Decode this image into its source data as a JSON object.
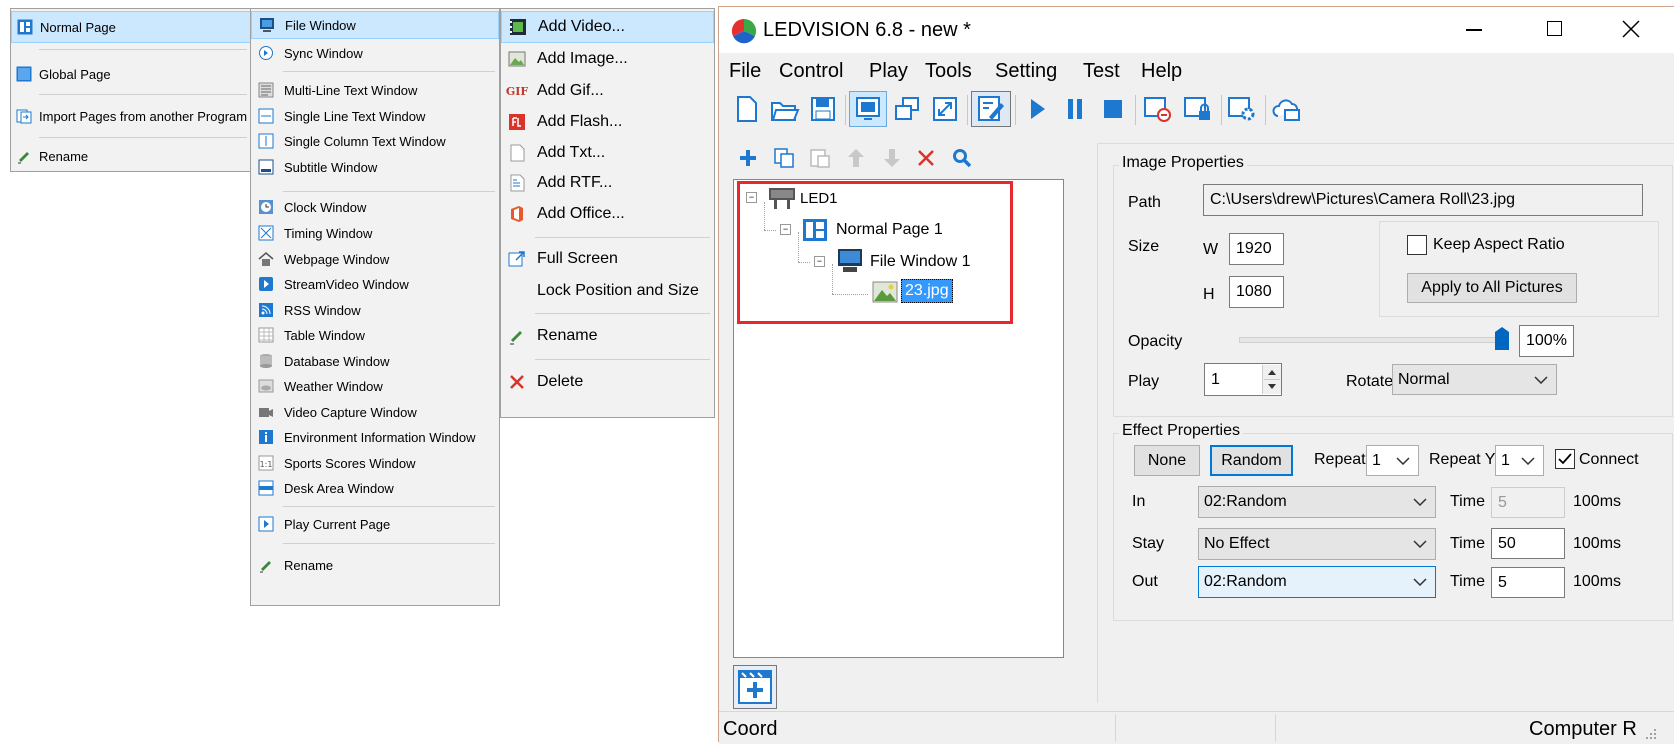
{
  "page_menu": {
    "items": [
      {
        "label": "Normal Page",
        "icon": "normal-page-icon"
      },
      {
        "label": "Global Page",
        "icon": "global-page-icon"
      },
      {
        "label": "Import Pages from another Program",
        "icon": "import-pages-icon"
      },
      {
        "label": "Rename",
        "icon": "rename-pen-icon"
      }
    ]
  },
  "window_menu": {
    "items": [
      {
        "label": "File Window"
      },
      {
        "label": "Sync Window"
      },
      {
        "label": "Multi-Line Text Window"
      },
      {
        "label": "Single Line Text Window"
      },
      {
        "label": "Single Column Text Window"
      },
      {
        "label": "Subtitle Window"
      },
      {
        "label": "Clock Window"
      },
      {
        "label": "Timing Window"
      },
      {
        "label": "Webpage Window"
      },
      {
        "label": "StreamVideo Window"
      },
      {
        "label": "RSS Window"
      },
      {
        "label": "Table Window"
      },
      {
        "label": "Database Window"
      },
      {
        "label": "Weather Window"
      },
      {
        "label": "Video Capture Window"
      },
      {
        "label": "Environment Information Window"
      },
      {
        "label": "Sports Scores Window"
      },
      {
        "label": "Desk Area Window"
      },
      {
        "label": "Play Current Page"
      },
      {
        "label": "Rename"
      }
    ]
  },
  "add_menu": {
    "items": [
      {
        "label": "Add Video..."
      },
      {
        "label": "Add Image..."
      },
      {
        "label": "Add Gif...",
        "icon_text": "GIF"
      },
      {
        "label": "Add Flash..."
      },
      {
        "label": "Add Txt..."
      },
      {
        "label": "Add RTF..."
      },
      {
        "label": "Add Office..."
      },
      {
        "label": "Full Screen"
      },
      {
        "label": "Lock Position and Size"
      },
      {
        "label": "Rename"
      },
      {
        "label": "Delete"
      }
    ]
  },
  "app": {
    "title": "LEDVISION 6.8 - new *",
    "menubar": [
      "File",
      "Control",
      "Play",
      "Tools",
      "Setting",
      "Test",
      "Help"
    ],
    "tree": {
      "led": "LED1",
      "page": "Normal Page 1",
      "window": "File Window 1",
      "file": "23.jpg"
    },
    "image_props": {
      "title": "Image Properties",
      "path_label": "Path",
      "path_value": "C:\\Users\\drew\\Pictures\\Camera Roll\\23.jpg",
      "size_label": "Size",
      "w_label": "W",
      "w_value": "1920",
      "h_label": "H",
      "h_value": "1080",
      "keep_aspect": "Keep Aspect Ratio",
      "keep_aspect_checked": false,
      "apply_all": "Apply to All Pictures",
      "opacity_label": "Opacity",
      "opacity_value": "100%",
      "opacity_level": 1.0,
      "play_label": "Play",
      "play_value": "1",
      "rotate_label": "Rotate",
      "rotate_value": "Normal"
    },
    "effect_props": {
      "title": "Effect Properties",
      "none_btn": "None",
      "random_btn": "Random",
      "repeat_label": "Repeat",
      "repeat_value": "1",
      "repeat_y_label": "Repeat Y",
      "repeat_y_value": "1",
      "connect_label": "Connect",
      "connect_checked": true,
      "rows": [
        {
          "label": "In",
          "effect": "02:Random",
          "time_label": "Time",
          "time": "5",
          "unit": "100ms"
        },
        {
          "label": "Stay",
          "effect": "No Effect",
          "time_label": "Time",
          "time": "50",
          "unit": "100ms"
        },
        {
          "label": "Out",
          "effect": "02:Random",
          "time_label": "Time",
          "time": "5",
          "unit": "100ms"
        }
      ]
    },
    "status": {
      "left": "Coord",
      "right": "Computer R"
    },
    "colors": {
      "highlight": "#cce8ff",
      "accent_blue": "#1e78d0",
      "tree_box_red": "#e8282d",
      "title_border": "#cfa48a"
    }
  }
}
